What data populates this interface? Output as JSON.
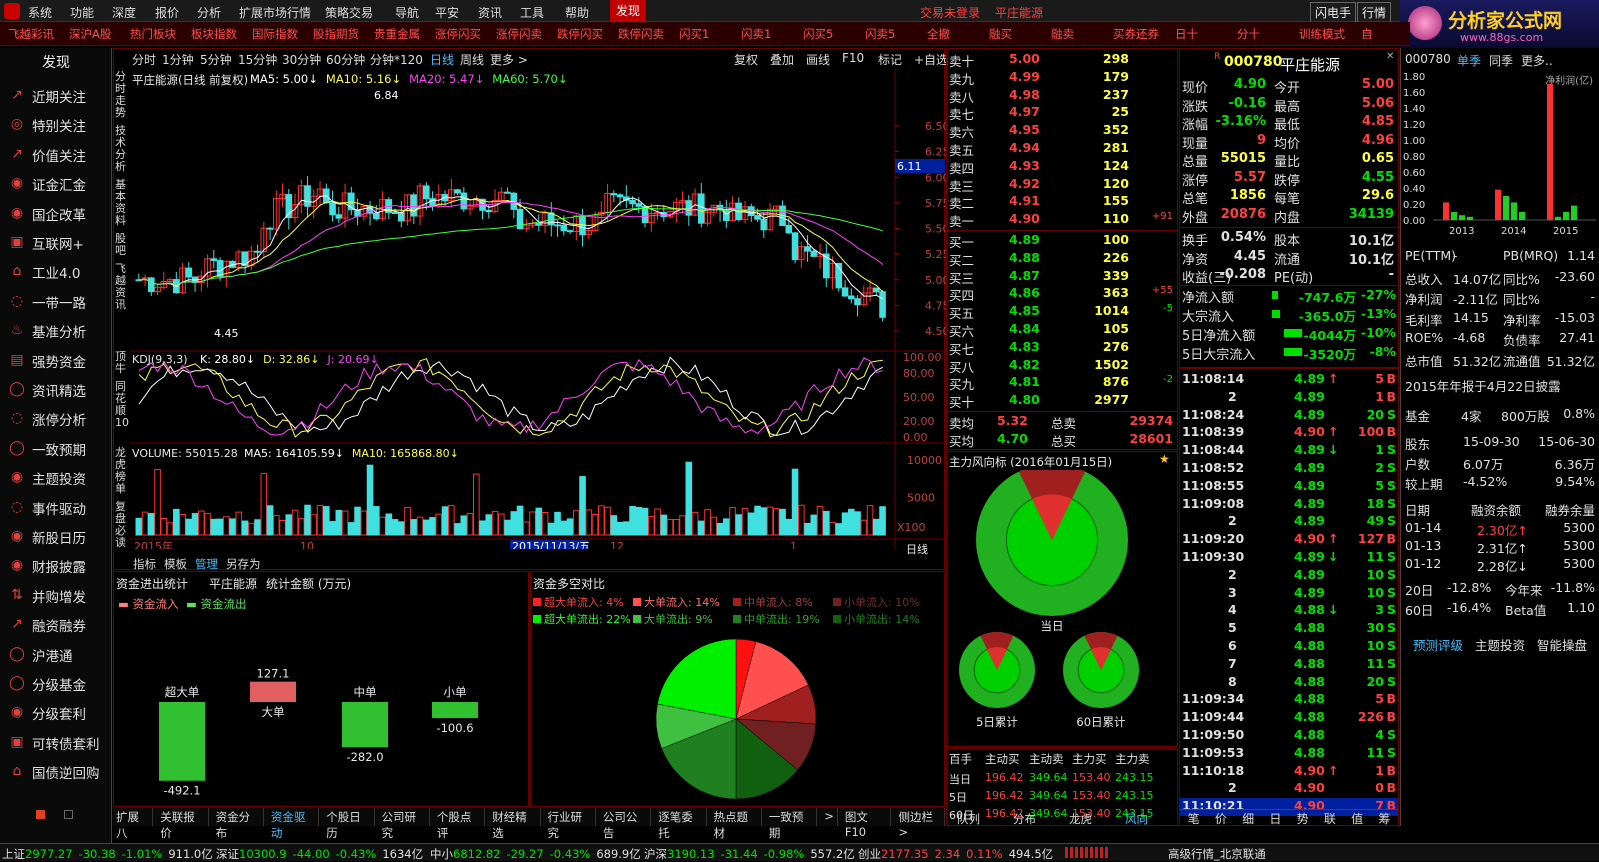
{
  "menu": [
    "系统",
    "功能",
    "深度",
    "报价",
    "分析",
    "扩展市场行情",
    "策略交易",
    "导航",
    "平安",
    "资讯",
    "工具",
    "帮助"
  ],
  "menu_active": "发现",
  "status_msgs": [
    "交易未登录",
    "平庄能源"
  ],
  "menu_right": [
    "闪电手",
    "行情"
  ],
  "watermark": {
    "title": "分析家公式网",
    "url": "www.88gs.com"
  },
  "toolbar": [
    "飞越彩讯",
    "深沪A股",
    "热门板块",
    "板块指数",
    "国际指数",
    "股指期货",
    "贵重金属",
    "涨停闪买",
    "涨停闪卖",
    "跌停闪买",
    "跌停闪卖",
    "闪买1",
    "闪卖1",
    "闪买5",
    "闪卖5",
    "全撤",
    "融买",
    "融卖",
    "买券还券",
    "日十",
    "分十",
    "训练模式",
    "自"
  ],
  "left_title": "发现",
  "left_items": [
    "近期关注",
    "特别关注",
    "价值关注",
    "证金汇金",
    "国企改革",
    "互联网+",
    "工业4.0",
    "一带一路",
    "基准分析",
    "强势资金",
    "资讯精选",
    "涨停分析",
    "一致预期",
    "主题投资",
    "事件驱动",
    "新股日历",
    "财报披露",
    "并购增发",
    "融资融券",
    "沪港通",
    "分级基金",
    "分级套利",
    "可转债套利",
    "国债逆回购"
  ],
  "period_tabs": [
    "分时",
    "1分钟",
    "5分钟",
    "15分钟",
    "30分钟",
    "60分钟",
    "分钟*120",
    "日线",
    "周线",
    "更多 >"
  ],
  "period_active": "日线",
  "chart_tools": [
    "复权",
    "叠加",
    "画线",
    "F10",
    "标记",
    "+自选"
  ],
  "side_tabs_a": [
    "分时走势",
    "技术分析",
    "基本资料",
    "股吧",
    "飞越资讯"
  ],
  "side_tabs_b": [
    "顶牛",
    "同花顺10",
    "龙虎榜单",
    "复盘必读"
  ],
  "chart_data": [
    {
      "type": "candlestick",
      "title": "平庄能源(日线 前复权)",
      "ma_labels": [
        "MA5: 5.00",
        "MA10: 5.16",
        "MA20: 5.47",
        "MA60: 5.70"
      ],
      "ylim": [
        4.5,
        6.5
      ],
      "yticks": [
        "6.50",
        "6.25",
        "6.00",
        "5.75",
        "5.50",
        "5.25",
        "5.00",
        "4.75",
        "4.50"
      ],
      "price_tag": "6.11",
      "annotations": [
        "6.84",
        "4.45"
      ],
      "xlabels": [
        "2015年",
        "10",
        "2015/11/13/五",
        "12",
        "1"
      ],
      "period_label": "日线"
    },
    {
      "type": "line",
      "title": "KDJ(9,3,3)",
      "values_text": [
        "K: 28.80",
        "D: 32.86",
        "J: 20.69"
      ],
      "yticks": [
        "100.00",
        "80.00",
        "50.00",
        "20.00",
        "0.00"
      ]
    },
    {
      "type": "bar",
      "title": "VOLUME: 55015.28",
      "values_text": [
        "MA5: 164105.59",
        "MA10: 165868.80"
      ],
      "yticks": [
        "10000",
        "5000"
      ],
      "unit": "X100"
    }
  ],
  "bottom_tabs": [
    "指标",
    "模板",
    "管理",
    "另存为"
  ],
  "fund_stats": {
    "title": "资金进出统计",
    "stock": "平庄能源",
    "unit": "统计金额 (万元)",
    "legend": [
      "资金流入",
      "资金流出"
    ],
    "cats": [
      "超大单",
      "大单",
      "中单",
      "小单"
    ],
    "values": [
      -492.1,
      127.1,
      -282.0,
      -100.6
    ],
    "value_labels": [
      "-492.1",
      "127.1",
      "-282.0",
      "-100.6"
    ]
  },
  "pie": {
    "title": "资金多空对比",
    "in": [
      {
        "n": "超大单流入:",
        "v": "4%",
        "c": "#ff2020"
      },
      {
        "n": "大单流入:",
        "v": "14%",
        "c": "#ff5050"
      },
      {
        "n": "中单流入:",
        "v": "8%",
        "c": "#a02020"
      },
      {
        "n": "小单流入:",
        "v": "10%",
        "c": "#702020"
      }
    ],
    "out": [
      {
        "n": "超大单流出:",
        "v": "22%",
        "c": "#00f000"
      },
      {
        "n": "大单流出:",
        "v": "9%",
        "c": "#40c040"
      },
      {
        "n": "中单流出:",
        "v": "19%",
        "c": "#208020"
      },
      {
        "n": "小单流出:",
        "v": "14%",
        "c": "#106010"
      }
    ],
    "slices": [
      4,
      14,
      8,
      10,
      14,
      19,
      9,
      22
    ]
  },
  "footer_tabs": [
    "扩展八",
    "关联报价",
    "资金分布",
    "资金驱动",
    "个股日历",
    "公司研究",
    "个股点评",
    "财经精选",
    "行业研究",
    "公司公告",
    "逐笔委托",
    "热点题材",
    "一致预期",
    ">",
    "图文F10",
    "侧边栏>"
  ],
  "footer_active": "资金驱动",
  "orderbook": {
    "sell": [
      [
        "卖十",
        "5.00",
        "298",
        ""
      ],
      [
        "卖九",
        "4.99",
        "179",
        ""
      ],
      [
        "卖八",
        "4.98",
        "237",
        ""
      ],
      [
        "卖七",
        "4.97",
        "25",
        ""
      ],
      [
        "卖六",
        "4.95",
        "352",
        ""
      ],
      [
        "卖五",
        "4.94",
        "281",
        ""
      ],
      [
        "卖四",
        "4.93",
        "124",
        ""
      ],
      [
        "卖三",
        "4.92",
        "120",
        ""
      ],
      [
        "卖二",
        "4.91",
        "155",
        ""
      ],
      [
        "卖一",
        "4.90",
        "110",
        "+91"
      ]
    ],
    "buy": [
      [
        "买一",
        "4.89",
        "100",
        ""
      ],
      [
        "买二",
        "4.88",
        "226",
        ""
      ],
      [
        "买三",
        "4.87",
        "339",
        ""
      ],
      [
        "买四",
        "4.86",
        "363",
        "+55"
      ],
      [
        "买五",
        "4.85",
        "1014",
        "-5"
      ],
      [
        "买六",
        "4.84",
        "105",
        ""
      ],
      [
        "买七",
        "4.83",
        "276",
        ""
      ],
      [
        "买八",
        "4.82",
        "1502",
        ""
      ],
      [
        "买九",
        "4.81",
        "876",
        "-2"
      ],
      [
        "买十",
        "4.80",
        "2977",
        ""
      ]
    ],
    "sell_avg": [
      "卖均",
      "5.32",
      "总卖",
      "29374"
    ],
    "buy_avg": [
      "买均",
      "4.70",
      "总买",
      "28601"
    ]
  },
  "radar": {
    "title": "主力风向标 (2016年01月15日)",
    "labels": [
      "当日",
      "5日累计",
      "60日累计"
    ]
  },
  "flow_table": {
    "headers": [
      "百手",
      "主动买",
      "主动卖",
      "主力买",
      "主力卖"
    ],
    "rows": [
      [
        "当日",
        "196.42",
        "349.64",
        "153.40",
        "243.15"
      ],
      [
        "5日",
        "196.42",
        "349.64",
        "153.40",
        "243.15"
      ],
      [
        "60日",
        "196.42",
        "349.64",
        "153.40",
        "243.15"
      ]
    ]
  },
  "bottom_mid_tabs": [
    "队列",
    "分布",
    "龙虎",
    "风向"
  ],
  "quote": {
    "code": "000780",
    "name": "平庄能源",
    "rows": [
      [
        "现价",
        "4.90",
        "今开",
        "5.00"
      ],
      [
        "涨跌",
        "-0.16",
        "最高",
        "5.06"
      ],
      [
        "涨幅",
        "-3.16%",
        "最低",
        "4.85"
      ],
      [
        "现量",
        "9",
        "均价",
        "4.96"
      ],
      [
        "总量",
        "55015",
        "量比",
        "0.65"
      ],
      [
        "涨停",
        "5.57",
        "跌停",
        "4.55"
      ],
      [
        "总笔",
        "1856",
        "每笔",
        "29.6"
      ],
      [
        "外盘",
        "20876",
        "内盘",
        "34139"
      ]
    ],
    "rows2": [
      [
        "换手",
        "0.54%",
        "股本",
        "10.1亿"
      ],
      [
        "净资",
        "4.45",
        "流通",
        "10.1亿"
      ],
      [
        "收益(三)",
        "-0.208",
        "PE(动)",
        "-"
      ]
    ],
    "flows": [
      [
        "净流入额",
        "-747.6万",
        "-27%"
      ],
      [
        "大宗流入",
        "-365.0万",
        "-13%"
      ],
      [
        "5日净流入额",
        "-4044万",
        "-10%"
      ],
      [
        "5日大宗流入",
        "-3520万",
        "-8%"
      ]
    ]
  },
  "ticks": [
    [
      "11:08:14",
      "4.89",
      "↑",
      "5",
      "B"
    ],
    [
      "2",
      "4.89",
      "",
      "1",
      "B"
    ],
    [
      "11:08:24",
      "4.89",
      "",
      "20",
      "S"
    ],
    [
      "11:08:39",
      "4.90",
      "↑",
      "100",
      "B"
    ],
    [
      "11:08:44",
      "4.89",
      "↓",
      "1",
      "S"
    ],
    [
      "11:08:52",
      "4.89",
      "",
      "2",
      "S"
    ],
    [
      "11:08:55",
      "4.89",
      "",
      "5",
      "S"
    ],
    [
      "11:09:08",
      "4.89",
      "",
      "18",
      "S"
    ],
    [
      "2",
      "4.89",
      "",
      "49",
      "S"
    ],
    [
      "11:09:20",
      "4.90",
      "↑",
      "127",
      "B"
    ],
    [
      "11:09:30",
      "4.89",
      "↓",
      "11",
      "S"
    ],
    [
      "2",
      "4.89",
      "",
      "10",
      "S"
    ],
    [
      "3",
      "4.89",
      "",
      "10",
      "S"
    ],
    [
      "4",
      "4.88",
      "↓",
      "3",
      "S"
    ],
    [
      "5",
      "4.88",
      "",
      "30",
      "S"
    ],
    [
      "6",
      "4.88",
      "",
      "10",
      "S"
    ],
    [
      "7",
      "4.88",
      "",
      "11",
      "S"
    ],
    [
      "8",
      "4.88",
      "",
      "20",
      "S"
    ],
    [
      "11:09:34",
      "4.88",
      "",
      "5",
      "B"
    ],
    [
      "11:09:44",
      "4.88",
      "",
      "226",
      "B"
    ],
    [
      "11:09:50",
      "4.88",
      "",
      "4",
      "S"
    ],
    [
      "11:09:53",
      "4.88",
      "",
      "11",
      "S"
    ],
    [
      "11:10:18",
      "4.90",
      "↑",
      "1",
      "B"
    ],
    [
      "2",
      "4.90",
      "",
      "0",
      "B"
    ],
    [
      "11:10:21",
      "4.90",
      "",
      "7",
      "B"
    ]
  ],
  "tick_tabs": [
    "笔",
    "价",
    "细",
    "日",
    "势",
    "联",
    "值",
    "筹"
  ],
  "f10": {
    "code": "000780",
    "tabs": [
      "单季",
      "同季",
      "更多.."
    ],
    "profit_label": "净利润(亿)",
    "yticks": [
      "1.80",
      "1.60",
      "1.40",
      "1.20",
      "1.00",
      "0.80",
      "0.60",
      "0.40",
      "0.20",
      "0.00"
    ],
    "years": [
      "2013",
      "2014",
      "2015"
    ],
    "rows": [
      [
        "PE(TTM)",
        "-",
        "PB(MRQ)",
        "1.14"
      ],
      [
        "总收入",
        "14.07亿",
        "同比%",
        "-23.60"
      ],
      [
        "净利润",
        "-2.11亿",
        "同比%",
        "-"
      ],
      [
        "毛利率",
        "14.15",
        "净利率",
        "-15.03"
      ],
      [
        "ROE%",
        "-4.68",
        "负债率",
        "27.41"
      ],
      [
        "总市值",
        "51.32亿",
        "流通值",
        "51.32亿"
      ]
    ],
    "report": "2015年年报于4月22日披露",
    "fund": [
      "基金",
      "4家",
      "800万股",
      "0.8%"
    ],
    "holder": [
      [
        "股东",
        "15-09-30",
        "15-06-30"
      ],
      [
        "户数",
        "6.07万",
        "6.36万"
      ],
      [
        "较上期",
        "-4.52%",
        "9.54%"
      ]
    ],
    "margin": {
      "headers": [
        "日期",
        "融资余额",
        "融券余量"
      ],
      "rows": [
        [
          "01-14",
          "2.30亿↑",
          "5300"
        ],
        [
          "01-13",
          "2.31亿↑",
          "5300"
        ],
        [
          "01-12",
          "2.28亿↓",
          "5300"
        ]
      ]
    },
    "perf": [
      [
        "20日",
        "-12.8%",
        "今年来",
        "-11.8%"
      ],
      [
        "60日",
        "-16.4%",
        "Beta值",
        "1.10"
      ]
    ],
    "links": [
      "预测评级",
      "主题投资",
      "智能操盘"
    ],
    "profit_bars": [
      [
        0.22,
        0.1,
        0.06,
        0.04
      ],
      [
        0.38,
        0.3,
        0.22,
        0.1
      ],
      [
        1.7,
        0.04,
        0.1,
        0.18
      ]
    ]
  },
  "statusbar": [
    [
      "上证",
      "2977.27",
      "-30.38",
      "-1.01%",
      "911.0亿"
    ],
    [
      "深证",
      "10300.9",
      "-44.00",
      "-0.43%",
      "1634亿"
    ],
    [
      "中小",
      "6812.82",
      "-29.27",
      "-0.43%",
      "689.9亿"
    ],
    [
      "沪深",
      "3190.13",
      "-31.44",
      "-0.98%",
      "557.2亿"
    ],
    [
      "创业",
      "2177.35",
      "2.34",
      "0.11%",
      "494.5亿"
    ]
  ],
  "status_right": "高级行情_北京联通"
}
